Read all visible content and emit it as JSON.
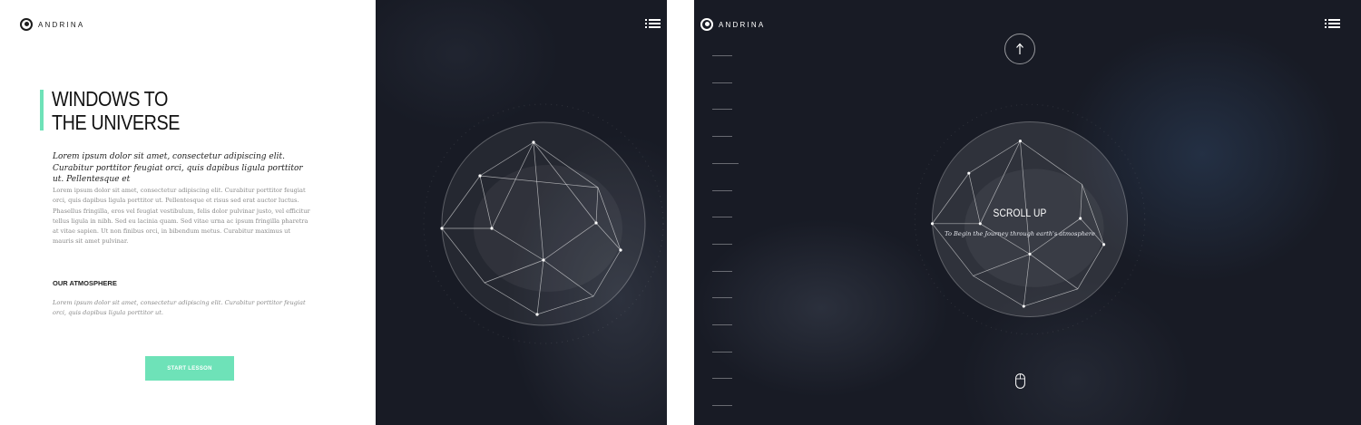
{
  "brand": {
    "name": "ANDRINA",
    "logo_icon": "head-silhouette-icon"
  },
  "hero": {
    "title_line1": "WINDOWS TO",
    "title_line2": "THE UNIVERSE",
    "lead": "Lorem ipsum dolor sit amet, consectetur adipiscing elit. Curabitur porttitor feugiat orci, quis dapibus ligula porttitor ut. Pellentesque et",
    "body": "Lorem ipsum dolor sit amet, consectetur adipiscing elit. Curabitur porttitor feugiat orci, quis dapibus ligula porttitor ut. Pellentesque et risus sed erat auctor luctus. Phasellus fringilla, eros vel feugiat vestibulum, felis dolor pulvinar justo, vel efficitur tellus ligula in nibh. Sed eu lacinia quam. Sed vitae urna ac ipsum fringilla pharetra at vitae sapien. Ut non finibus orci, in bibendum metus. Curabitur maximus ut mauris sit amet pulvinar."
  },
  "atmosphere": {
    "heading": "OUR ATMOSPHERE",
    "text": "Lorem ipsum dolor sit amet, consectetur adipiscing elit. Curabitur porttitor feugiat orci, quis dapibus ligula porttitor ut."
  },
  "cta": {
    "label": "START LESSON"
  },
  "menu": {
    "icon": "menu-list-icon"
  },
  "scroll": {
    "title": "SCROLL UP",
    "subtitle": "To Begin the Journey through earth's atmosphere",
    "up_icon": "arrow-up-icon",
    "mouse_icon": "mouse-icon"
  },
  "colors": {
    "accent": "#6ee2b8",
    "space": "#181b25",
    "text_dark": "#111111",
    "text_muted": "#8a8a8a"
  }
}
